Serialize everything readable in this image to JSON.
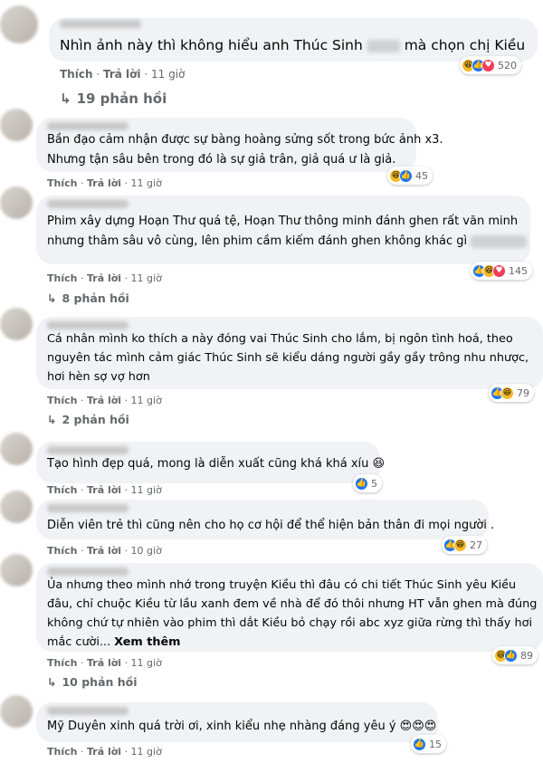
{
  "labels": {
    "like": "Thích",
    "reply": "Trả lời",
    "dot": "·",
    "see_more": "Xem thêm"
  },
  "comments": [
    {
      "text": [
        "Nhìn ảnh này thì không hiểu anh Thúc Sinh",
        "mà chọn chị Kiều"
      ],
      "time": "11 giờ",
      "reactions": [
        "haha",
        "like",
        "love"
      ],
      "count": "520",
      "replies": "19 phản hồi"
    },
    {
      "text": [
        "Bần đạo cảm nhận được sự bàng hoàng sửng sốt trong bức ảnh x3.",
        "Nhưng tận sâu bên trong đó là sự giả trân, giả quá ư là giả."
      ],
      "time": "11 giờ",
      "reactions": [
        "haha",
        "like"
      ],
      "count": "45"
    },
    {
      "text": [
        "Phim xây dựng Hoạn Thư quá tệ, Hoạn Thư thông minh đánh ghen rất văn minh",
        "nhưng thâm sâu vô cùng, lên phim cầm kiếm đánh ghen không khác gì"
      ],
      "time": "11 giờ",
      "reactions": [
        "like",
        "haha",
        "love"
      ],
      "count": "145",
      "replies": "8 phản hồi"
    },
    {
      "text": [
        "Cá nhân mình ko thích a này đóng vai Thúc Sinh cho lắm, bị ngôn tình hoá, theo",
        "nguyên tác mình cảm giác Thúc Sinh sẽ kiểu dáng người gầy gầy trông nhu nhược,",
        "hơi hèn sợ vợ hơn"
      ],
      "time": "11 giờ",
      "reactions": [
        "like",
        "haha"
      ],
      "count": "79",
      "replies": "2 phản hồi"
    },
    {
      "text": [
        "Tạo hình đẹp quá, mong là diễn xuất cũng khá khá xíu 😆"
      ],
      "time": "11 giờ",
      "reactions": [
        "like"
      ],
      "count": "5"
    },
    {
      "text": [
        "Diễn viên trẻ thì cũng nên cho họ cơ hội để thể hiện bản thân đi mọi người ."
      ],
      "time": "10 giờ",
      "reactions": [
        "like",
        "haha"
      ],
      "count": "27"
    },
    {
      "text": [
        "Ủa nhưng theo mình nhớ trong truyện Kiều thì đâu có chi tiết Thúc Sinh yêu Kiều",
        "đâu, chỉ chuộc Kiều từ lầu xanh đem về nhà để đó thôi nhưng HT vẫn ghen mà đúng",
        "không chứ tự nhiên vào phim thì dắt Kiều bỏ chạy rồi abc xyz giữa rừng thì thấy hơi",
        "mắc cười..."
      ],
      "time": "11 giờ",
      "reactions": [
        "haha",
        "like"
      ],
      "count": "89",
      "replies": "10 phản hồi"
    },
    {
      "text": [
        "Mỹ Duyên xinh quá trời ơi, xinh kiểu nhẹ nhàng đáng yêu ý 😍😍😍"
      ],
      "time": "11 giờ",
      "reactions": [
        "like"
      ],
      "count": "15"
    }
  ]
}
